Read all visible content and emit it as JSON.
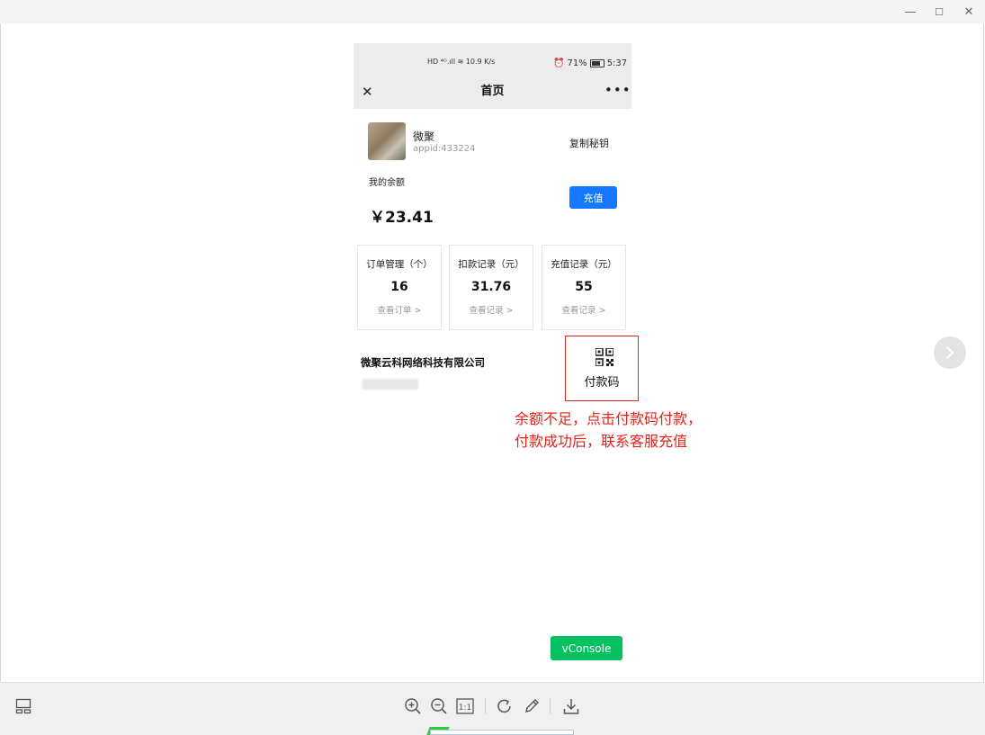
{
  "window": {
    "minimize": "—",
    "maximize": "☐",
    "close": "✕"
  },
  "status_bar": {
    "left": "HD ⁴ᴳ.ıll ≋ 10.9 K/s",
    "battery_percent": "71%",
    "time": "5:37"
  },
  "nav": {
    "title": "首页",
    "close_glyph": "✕",
    "more_glyph": "•••"
  },
  "user": {
    "name": "微聚",
    "appid": "appid:433224",
    "copy_key_label": "复制秘钥"
  },
  "balance": {
    "label": "我的余额",
    "amount": "￥23.41",
    "recharge_label": "充值"
  },
  "cards": [
    {
      "title": "订单管理（个）",
      "value": "16",
      "link": "查看订单 >"
    },
    {
      "title": "扣款记录（元）",
      "value": "31.76",
      "link": "查看记录 >"
    },
    {
      "title": "充值记录（元）",
      "value": "55",
      "link": "查看记录 >"
    }
  ],
  "company": "微聚云科网络科技有限公司",
  "qr": {
    "label": "付款码"
  },
  "annotation": {
    "line1": "余额不足，点击付款码付款，",
    "line2": "付款成功后，联系客服充值"
  },
  "vconsole_label": "vConsole",
  "colors": {
    "accent_blue": "#1677ff",
    "annotation_red": "#e2231a",
    "vconsole_green": "#07c160"
  }
}
